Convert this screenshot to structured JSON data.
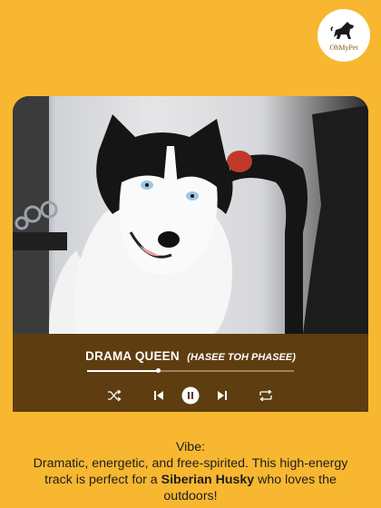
{
  "brand": {
    "name": "OhMyPet"
  },
  "player": {
    "title": "DRAMA QUEEN",
    "subtitle": "(HASEE TOH PHASEE)",
    "progress": 0.34,
    "controls": [
      "shuffle-icon",
      "previous-icon",
      "pause-icon",
      "next-icon",
      "repeat-icon"
    ]
  },
  "caption": {
    "heading": "Vibe:",
    "text_before": "Dramatic, energetic, and free-spirited. This high-energy track is perfect for a ",
    "breed": "Siberian Husky",
    "text_after": " who loves the outdoors!"
  },
  "colors": {
    "background": "#F7B731",
    "player_bar": "#5E3D10",
    "text": "#1E1E1E"
  }
}
